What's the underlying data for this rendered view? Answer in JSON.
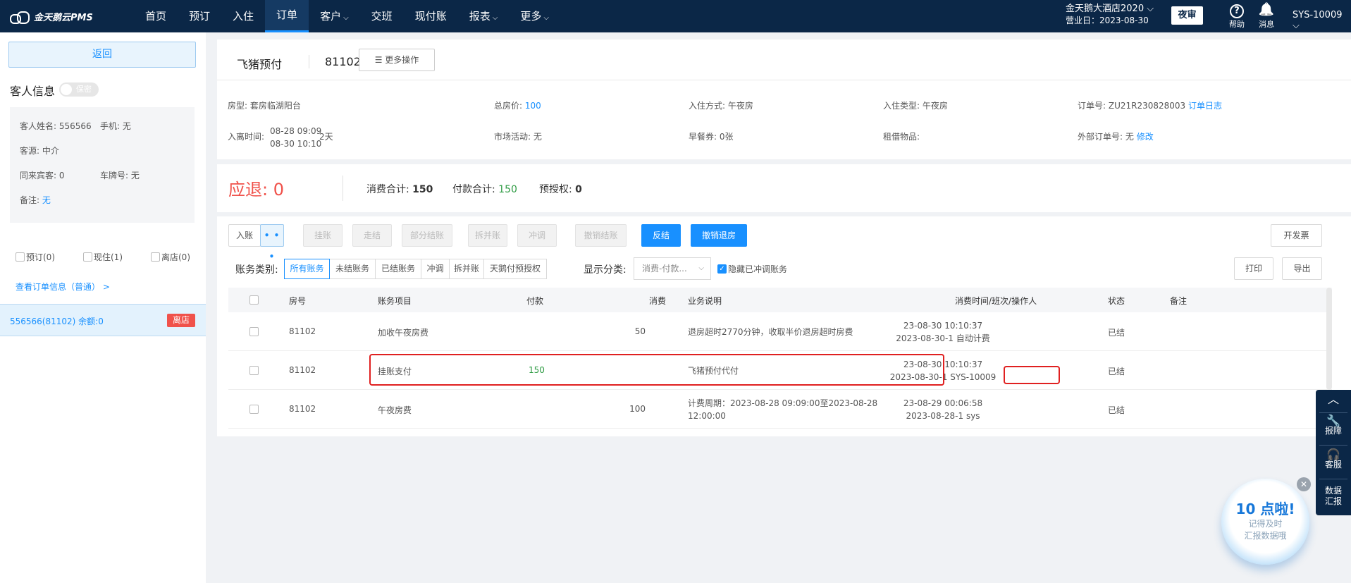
{
  "topbar": {
    "logo": "金天鹅云PMS",
    "nav": [
      {
        "label": "首页",
        "caret": ""
      },
      {
        "label": "预订",
        "caret": ""
      },
      {
        "label": "入住",
        "caret": ""
      },
      {
        "label": "订单",
        "caret": ""
      },
      {
        "label": "客户",
        "caret": "⌵"
      },
      {
        "label": "交班",
        "caret": ""
      },
      {
        "label": "现付账",
        "caret": ""
      },
      {
        "label": "报表",
        "caret": "⌵"
      },
      {
        "label": "更多",
        "caret": "⌵"
      }
    ],
    "hotel_name": "金天鹅大酒店2020 ⌵",
    "business_day": "营业日：2023-08-30",
    "night_audit": "夜审",
    "help": "帮助",
    "help_glyph": "?",
    "messages": "消息",
    "bell_glyph": "🔔",
    "user": "SYS-10009 ⌵"
  },
  "sidebar": {
    "back": "返回",
    "guest_title": "客人信息",
    "toggle_label": "保密",
    "guest": {
      "name": "客人姓名: 556566",
      "phone": "手机: 无",
      "source": "客源: 中介",
      "companions": "同来宾客: 0",
      "plate": "车牌号: 无",
      "remark_label": "备注: ",
      "remark_value": "无"
    },
    "filters": [
      "预订(0)",
      "现住(1)",
      "离店(0)"
    ],
    "view_link": "查看订单信息（普通） >",
    "order_row": {
      "text": "556566(81102)  余额:0",
      "badge": "离店"
    }
  },
  "order": {
    "title": "飞猪预付",
    "number": "81102",
    "more_ops": "☰   更多操作",
    "fields": {
      "room_type": "房型: 套房临湖阳台",
      "total_price_label": "总房价: ",
      "total_price": "100",
      "checkin_method": "入住方式: 午夜房",
      "checkin_type": "入住类型: 午夜房",
      "order_no": "订单号: ZU21R230828003",
      "order_log": "订单日志",
      "stay_label": "入离时间:",
      "stay_in": "08-28 09:09",
      "stay_out": "08-30 10:10",
      "stay_days": "2天",
      "marketing": "市场活动: 无",
      "breakfast": "早餐券: 0张",
      "rental": "租借物品:",
      "external_label": "外部订单号: 无 ",
      "external_edit": "修改"
    }
  },
  "summary": {
    "refund_label": "应退: ",
    "refund_value": "0",
    "consume_label": "消费合计: ",
    "consume_value": "150",
    "payment_label": "付款合计: ",
    "payment_value": "150",
    "preauth_label": "预授权: ",
    "preauth_value": "0"
  },
  "actions": {
    "post": "入账",
    "dots": "• • •",
    "hang": "挂账",
    "walk": "走结",
    "partial": "部分结账",
    "split": "拆并账",
    "offset": "冲调",
    "cancel_settle": "撤销结账",
    "reverse": "反结",
    "cancel_checkout": "撤销退房",
    "invoice": "开发票",
    "print": "打印",
    "export": "导出"
  },
  "filter": {
    "category_label": "账务类别:",
    "segments": [
      "所有账务",
      "未结账务",
      "已结账务",
      "冲调",
      "拆并账",
      "天鹅付预授权"
    ],
    "display_label": "显示分类:",
    "display_value": "消费-付款...",
    "hide_offset": "隐藏已冲调账务"
  },
  "table": {
    "headers": [
      "房号",
      "账务项目",
      "付款",
      "消费",
      "业务说明",
      "消费时间/班次/操作人",
      "状态",
      "备注"
    ],
    "rows": [
      {
        "room": "81102",
        "item": "加收午夜房费",
        "payment": "",
        "consume": "50",
        "desc1": "退房超时2770分钟，收取半价退房超时房费",
        "desc2": "",
        "time1": "23-08-30 10:10:37",
        "time2": "2023-08-30-1 自动计费",
        "status": "已结",
        "remark": ""
      },
      {
        "room": "81102",
        "item": "挂账支付",
        "payment": "150",
        "consume": "",
        "desc1": "飞猪预付代付",
        "desc2": "",
        "time1": "23-08-30 10:10:37",
        "time2": "2023-08-30-1 SYS-10009",
        "status": "已结",
        "remark": ""
      },
      {
        "room": "81102",
        "item": "午夜房费",
        "payment": "",
        "consume": "100",
        "desc1": "计费周期：2023-08-28 09:09:00至2023-08-28",
        "desc2": "12:00:00",
        "time1": "23-08-29 00:06:58",
        "time2": "2023-08-28-1 sys",
        "status": "已结",
        "remark": ""
      }
    ]
  },
  "tools": {
    "up": "︿",
    "report": "报障",
    "service": "客服",
    "data1": "数据",
    "data2": "汇报"
  },
  "reminder": {
    "big": "10 点啦!",
    "line1": "记得及时",
    "line2": "汇报数据哦",
    "close": "✕"
  },
  "colors": {
    "nav_bg": "#0b2747",
    "accent": "#1890ff",
    "danger": "#f0524b",
    "success": "#2e9b43",
    "highlight": "#e02020"
  }
}
